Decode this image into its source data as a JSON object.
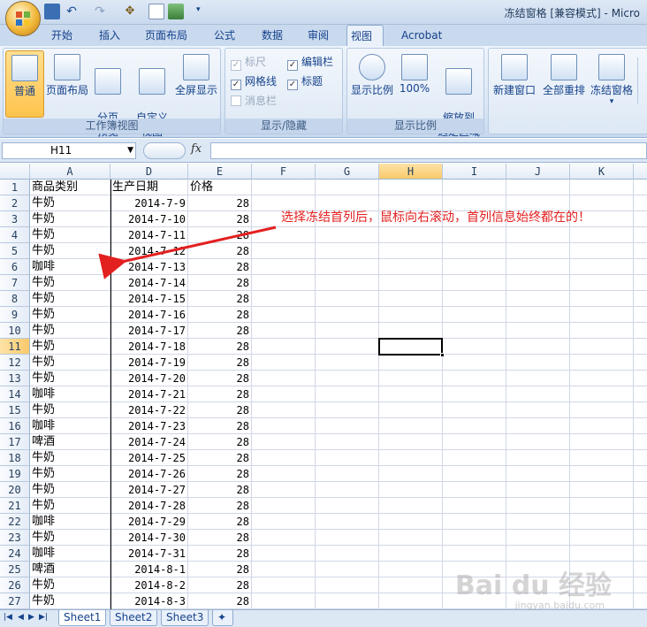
{
  "window": {
    "title": "冻结窗格  [兼容模式] - Micro"
  },
  "tabs": [
    {
      "label": "开始",
      "active": false
    },
    {
      "label": "插入",
      "active": false
    },
    {
      "label": "页面布局",
      "active": false
    },
    {
      "label": "公式",
      "active": false
    },
    {
      "label": "数据",
      "active": false
    },
    {
      "label": "审阅",
      "active": false
    },
    {
      "label": "视图",
      "active": true
    },
    {
      "label": "Acrobat",
      "active": false
    }
  ],
  "ribbon": {
    "workbook_views": {
      "label": "工作簿视图",
      "buttons": [
        {
          "label": "普通",
          "selected": true
        },
        {
          "label": "页面布局",
          "selected": false
        },
        {
          "label": "分页\n预览",
          "selected": false
        },
        {
          "label": "自定义\n视图",
          "selected": false
        },
        {
          "label": "全屏显示",
          "selected": false
        }
      ]
    },
    "show_hide": {
      "label": "显示/隐藏",
      "checkboxes": [
        {
          "label": "标尺",
          "checked": true,
          "disabled": true
        },
        {
          "label": "编辑栏",
          "checked": true,
          "disabled": false
        },
        {
          "label": "网格线",
          "checked": true,
          "disabled": false
        },
        {
          "label": "标题",
          "checked": true,
          "disabled": false
        },
        {
          "label": "消息栏",
          "checked": false,
          "disabled": true
        }
      ]
    },
    "zoom": {
      "label": "显示比例",
      "buttons": [
        {
          "label": "显示比例"
        },
        {
          "label": "100%"
        },
        {
          "label": "缩放到\n选定区域"
        }
      ]
    },
    "window": {
      "buttons": [
        {
          "label": "新建窗口"
        },
        {
          "label": "全部重排"
        },
        {
          "label": "冻结窗格"
        }
      ]
    }
  },
  "formula_bar": {
    "name_box": "H11",
    "fx": "fx",
    "value": ""
  },
  "sheet": {
    "columns": [
      "A",
      "D",
      "E",
      "F",
      "G",
      "H",
      "I",
      "J",
      "K"
    ],
    "active_column": "H",
    "active_row": "11",
    "rows": [
      {
        "n": "1",
        "a": "商品类别",
        "d": "生产日期",
        "e": "价格"
      },
      {
        "n": "2",
        "a": "牛奶",
        "d": "2014-7-9",
        "e": "28"
      },
      {
        "n": "3",
        "a": "牛奶",
        "d": "2014-7-10",
        "e": "28"
      },
      {
        "n": "4",
        "a": "牛奶",
        "d": "2014-7-11",
        "e": "28"
      },
      {
        "n": "5",
        "a": "牛奶",
        "d": "2014-7-12",
        "e": "28"
      },
      {
        "n": "6",
        "a": "咖啡",
        "d": "2014-7-13",
        "e": "28"
      },
      {
        "n": "7",
        "a": "牛奶",
        "d": "2014-7-14",
        "e": "28"
      },
      {
        "n": "8",
        "a": "牛奶",
        "d": "2014-7-15",
        "e": "28"
      },
      {
        "n": "9",
        "a": "牛奶",
        "d": "2014-7-16",
        "e": "28"
      },
      {
        "n": "10",
        "a": "牛奶",
        "d": "2014-7-17",
        "e": "28"
      },
      {
        "n": "11",
        "a": "牛奶",
        "d": "2014-7-18",
        "e": "28"
      },
      {
        "n": "12",
        "a": "牛奶",
        "d": "2014-7-19",
        "e": "28"
      },
      {
        "n": "13",
        "a": "牛奶",
        "d": "2014-7-20",
        "e": "28"
      },
      {
        "n": "14",
        "a": "咖啡",
        "d": "2014-7-21",
        "e": "28"
      },
      {
        "n": "15",
        "a": "牛奶",
        "d": "2014-7-22",
        "e": "28"
      },
      {
        "n": "16",
        "a": "咖啡",
        "d": "2014-7-23",
        "e": "28"
      },
      {
        "n": "17",
        "a": "啤酒",
        "d": "2014-7-24",
        "e": "28"
      },
      {
        "n": "18",
        "a": "牛奶",
        "d": "2014-7-25",
        "e": "28"
      },
      {
        "n": "19",
        "a": "牛奶",
        "d": "2014-7-26",
        "e": "28"
      },
      {
        "n": "20",
        "a": "牛奶",
        "d": "2014-7-27",
        "e": "28"
      },
      {
        "n": "21",
        "a": "牛奶",
        "d": "2014-7-28",
        "e": "28"
      },
      {
        "n": "22",
        "a": "咖啡",
        "d": "2014-7-29",
        "e": "28"
      },
      {
        "n": "23",
        "a": "牛奶",
        "d": "2014-7-30",
        "e": "28"
      },
      {
        "n": "24",
        "a": "咖啡",
        "d": "2014-7-31",
        "e": "28"
      },
      {
        "n": "25",
        "a": "啤酒",
        "d": "2014-8-1",
        "e": "28"
      },
      {
        "n": "26",
        "a": "牛奶",
        "d": "2014-8-2",
        "e": "28"
      },
      {
        "n": "27",
        "a": "牛奶",
        "d": "2014-8-3",
        "e": "28"
      }
    ]
  },
  "sheet_tabs": [
    {
      "label": "Sheet1",
      "active": true
    },
    {
      "label": "Sheet2",
      "active": false
    },
    {
      "label": "Sheet3",
      "active": false
    }
  ],
  "annotation": {
    "text": "选择冻结首列后，鼠标向右滚动，首列信息始终都在的！",
    "color": "#e32020"
  },
  "watermark": {
    "text": "Bai du 经验",
    "sub": "jingyan.baidu.com"
  }
}
